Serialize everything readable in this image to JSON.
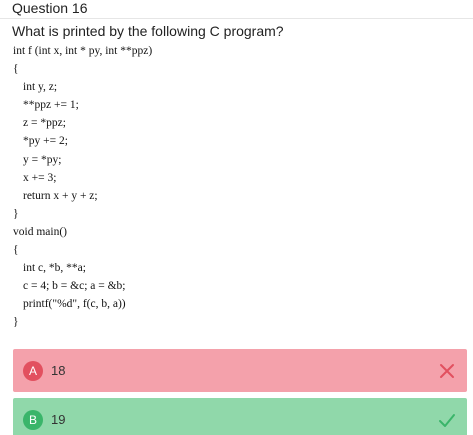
{
  "question": {
    "title": "Question 16",
    "prompt": "What is printed by the following C program?"
  },
  "code_lines": [
    "int f (int x, int * py, int **ppz)",
    "{",
    "int y, z;",
    "**ppz += 1;",
    "z = *ppz;",
    "*py += 2;",
    "y = *py;",
    "x += 3;",
    "return x + y + z;",
    "}",
    "void main()",
    "{",
    "int c, *b, **a;",
    "c = 4; b = &c; a = &b;",
    "printf(\"%d\", f(c, b, a))",
    "}"
  ],
  "options": [
    {
      "letter": "A",
      "value": "18",
      "status": "incorrect",
      "status_icon": "close-icon",
      "color": "#f4a1ab",
      "badge_color": "#e2505f"
    },
    {
      "letter": "B",
      "value": "19",
      "status": "correct",
      "status_icon": "check-icon",
      "color": "#90d8aa",
      "badge_color": "#3ab56a"
    }
  ]
}
